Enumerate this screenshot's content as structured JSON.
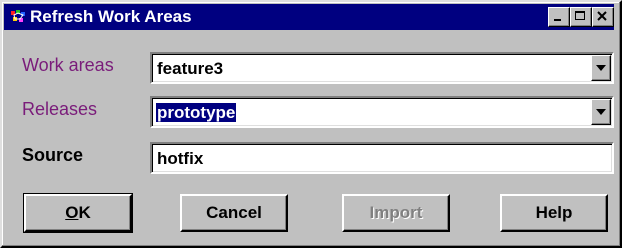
{
  "window": {
    "title": "Refresh Work Areas",
    "icon": "app-icon",
    "controls": {
      "minimize_icon": "minimize-icon",
      "maximize_icon": "maximize-icon",
      "close_icon": "close-icon"
    }
  },
  "form": {
    "work_areas": {
      "label": "Work areas",
      "value": "feature3",
      "type": "dropdown"
    },
    "releases": {
      "label": "Releases",
      "value": "prototype",
      "type": "dropdown",
      "selected_text": true
    },
    "source": {
      "label": "Source",
      "value": "hotfix",
      "type": "text"
    }
  },
  "buttons": {
    "ok": {
      "label": "OK",
      "mnemonic": "O"
    },
    "cancel": {
      "label": "Cancel"
    },
    "import": {
      "label": "Import",
      "disabled": true
    },
    "help": {
      "label": "Help"
    }
  },
  "colors": {
    "titlebar": "#000080",
    "window_face": "#c0c0c0",
    "label_accent": "#7a1c7a",
    "selection": "#000080"
  }
}
